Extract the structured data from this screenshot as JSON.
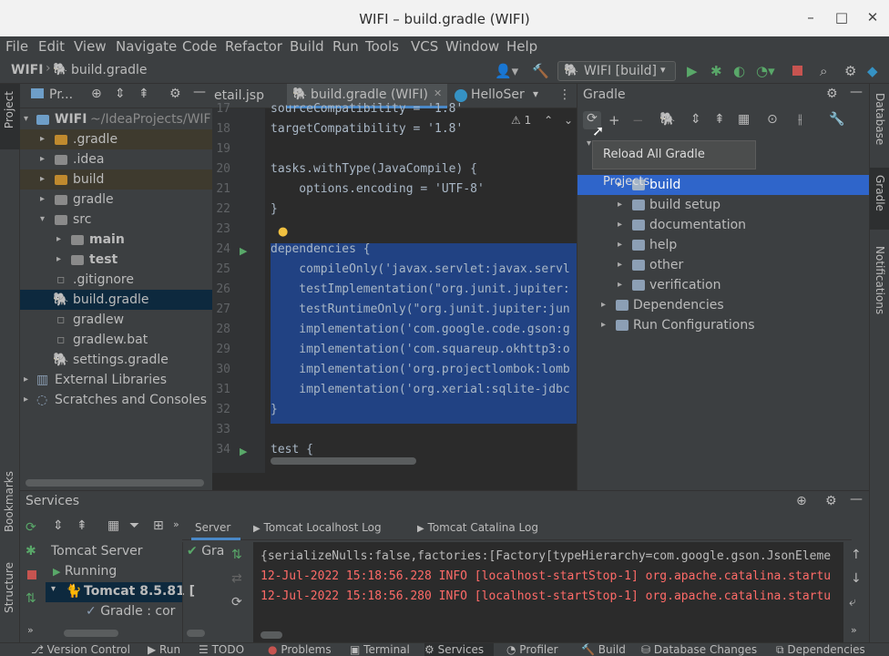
{
  "window": {
    "title": "WIFI – build.gradle (WIFI)"
  },
  "menu": [
    "File",
    "Edit",
    "View",
    "Navigate",
    "Code",
    "Refactor",
    "Build",
    "Run",
    "Tools",
    "VCS",
    "Window",
    "Help"
  ],
  "nav": {
    "project": "WIFI",
    "file": "build.gradle",
    "run_config": "WIFI [build]"
  },
  "left_tabs": {
    "project": "Project",
    "bookmarks": "Bookmarks",
    "structure": "Structure"
  },
  "right_tabs": {
    "database": "Database",
    "gradle": "Gradle",
    "notifications": "Notifications"
  },
  "project_panel": {
    "title": "Pr...",
    "tree": [
      {
        "name": "WIFI",
        "extra": "~/IdeaProjects/WIF"
      },
      {
        "name": ".gradle"
      },
      {
        "name": ".idea"
      },
      {
        "name": "build"
      },
      {
        "name": "gradle"
      },
      {
        "name": "src"
      },
      {
        "name": "main"
      },
      {
        "name": "test"
      },
      {
        "name": ".gitignore"
      },
      {
        "name": "build.gradle"
      },
      {
        "name": "gradlew"
      },
      {
        "name": "gradlew.bat"
      },
      {
        "name": "settings.gradle"
      },
      {
        "name": "External Libraries"
      },
      {
        "name": "Scratches and Consoles"
      }
    ]
  },
  "editor": {
    "tabs": [
      "etail.jsp",
      "build.gradle (WIFI)",
      "HelloSer"
    ],
    "warnings": "1",
    "lines": [
      {
        "n": "17",
        "t": "sourceCompatibility = '1.8'"
      },
      {
        "n": "18",
        "t": "targetCompatibility = '1.8'"
      },
      {
        "n": "19",
        "t": ""
      },
      {
        "n": "20",
        "t": "tasks.withType(JavaCompile) {"
      },
      {
        "n": "21",
        "t": "    options.encoding = 'UTF-8'"
      },
      {
        "n": "22",
        "t": "}"
      },
      {
        "n": "23",
        "t": ""
      },
      {
        "n": "24",
        "t": "dependencies {"
      },
      {
        "n": "25",
        "t": "    compileOnly('javax.servlet:javax.servl"
      },
      {
        "n": "26",
        "t": "    testImplementation(\"org.junit.jupiter:"
      },
      {
        "n": "27",
        "t": "    testRuntimeOnly(\"org.junit.jupiter:jun"
      },
      {
        "n": "28",
        "t": "    implementation('com.google.code.gson:g"
      },
      {
        "n": "29",
        "t": "    implementation('com.squareup.okhttp3:o"
      },
      {
        "n": "30",
        "t": "    implementation('org.projectlombok:lomb"
      },
      {
        "n": "31",
        "t": "    implementation('org.xerial:sqlite-jdbc"
      },
      {
        "n": "32",
        "t": "}"
      },
      {
        "n": "33",
        "t": ""
      },
      {
        "n": "34",
        "t": "test {"
      }
    ]
  },
  "gradle_panel": {
    "title": "Gradle",
    "tooltip": "Reload All Gradle Projects",
    "tasks": [
      "build",
      "build setup",
      "documentation",
      "help",
      "other",
      "verification"
    ],
    "groups": [
      "Dependencies",
      "Run Configurations"
    ]
  },
  "services": {
    "title": "Services",
    "tabs": [
      "Server",
      "Tomcat Localhost Log",
      "Tomcat Catalina Log"
    ],
    "tree": [
      "Tomcat Server",
      "Running",
      "Tomcat 8.5.81 [",
      "Gradle : cor"
    ],
    "gra_label": "Gra",
    "log": [
      {
        "text": "{serializeNulls:false,factories:[Factory[typeHierarchy=com.google.gson.JsonEleme",
        "color": "#bbbbbb"
      },
      {
        "text": "12-Jul-2022 15:18:56.228 INFO [localhost-startStop-1] org.apache.catalina.startu",
        "color": "#ff6b68"
      },
      {
        "text": "12-Jul-2022 15:18:56.280 INFO [localhost-startStop-1] org.apache.catalina.startu",
        "color": "#ff6b68"
      }
    ]
  },
  "statusbar": [
    "Version Control",
    "Run",
    "TODO",
    "Problems",
    "Terminal",
    "Services",
    "Profiler",
    "Build",
    "Database Changes",
    "Dependencies"
  ]
}
